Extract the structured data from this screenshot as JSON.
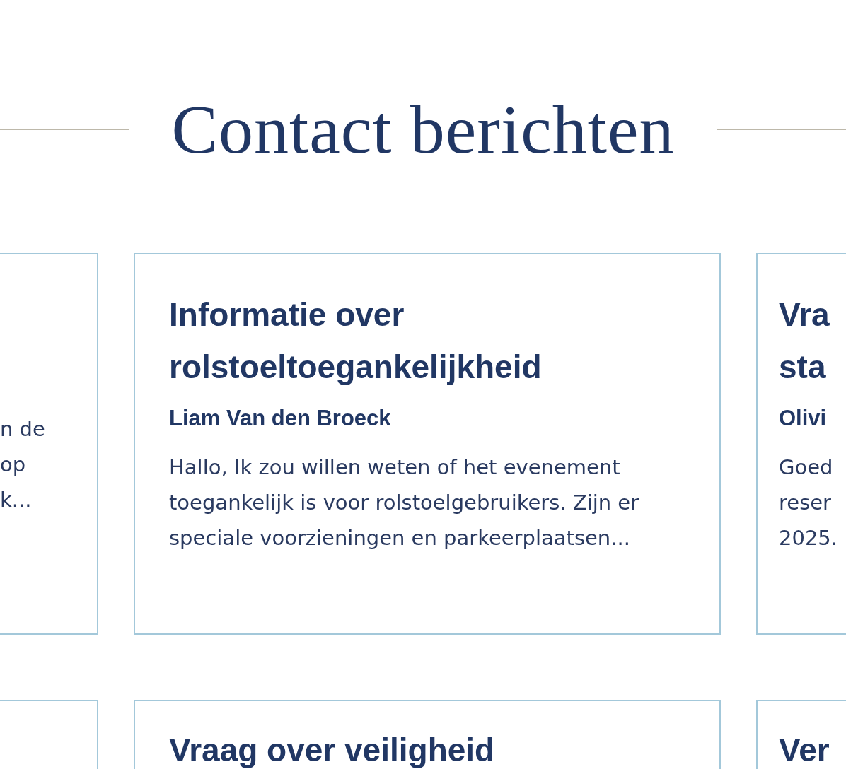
{
  "heading": "Contact berichten",
  "rows": [
    {
      "cards": [
        {
          "kind": "edge-left",
          "body_lines": [
            "n de",
            "op",
            "k..."
          ]
        },
        {
          "kind": "full",
          "title": "Informatie over rolstoeltoegankelijkheid",
          "author": "Liam Van den Broeck",
          "body": "Hallo, Ik zou willen weten of het evenement toegankelijk is voor rolstoelgebruikers. Zijn er speciale voorzieningen en parkeerplaatsen..."
        },
        {
          "kind": "edge-right",
          "title_lines": [
            "Vra",
            "sta"
          ],
          "author": "Olivi",
          "body_lines": [
            "Goed",
            "reser",
            "2025."
          ]
        }
      ]
    },
    {
      "cards": [
        {
          "kind": "edge-left"
        },
        {
          "kind": "full",
          "title": "Vraag over veiligheid"
        },
        {
          "kind": "edge-right",
          "title_lines": [
            "Ver"
          ]
        }
      ]
    }
  ]
}
